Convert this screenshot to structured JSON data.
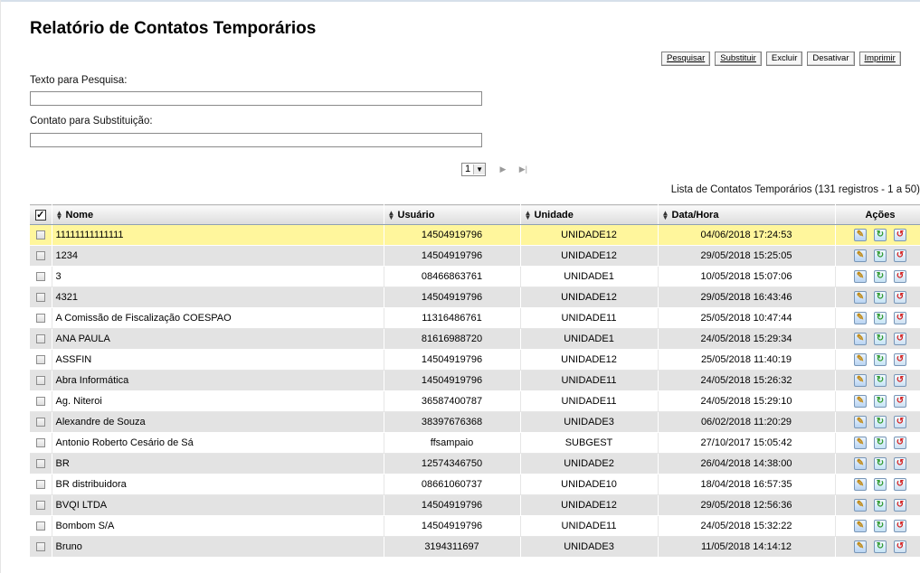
{
  "page": {
    "title": "Relatório de Contatos Temporários"
  },
  "toolbar": {
    "search_label": "Pesquisar",
    "replace_label": "Substituir",
    "delete_label": "Excluir",
    "deactivate_label": "Desativar",
    "print_label": "Imprimir"
  },
  "form": {
    "search_text_label": "Texto para Pesquisa:",
    "search_text_value": "",
    "replace_contact_label": "Contato para Substituição:",
    "replace_contact_value": ""
  },
  "pagination": {
    "current_page": "1"
  },
  "list": {
    "caption": "Lista de Contatos Temporários (131 registros - 1 a 50)",
    "columns": {
      "name": "Nome",
      "user": "Usuário",
      "unit": "Unidade",
      "datetime": "Data/Hora",
      "actions": "Ações"
    },
    "rows": [
      {
        "name": "11111111111111",
        "user": "14504919796",
        "unit": "UNIDADE12",
        "datetime": "04/06/2018 17:24:53"
      },
      {
        "name": "1234",
        "user": "14504919796",
        "unit": "UNIDADE12",
        "datetime": "29/05/2018 15:25:05"
      },
      {
        "name": "3",
        "user": "08466863761",
        "unit": "UNIDADE1",
        "datetime": "10/05/2018 15:07:06"
      },
      {
        "name": "4321",
        "user": "14504919796",
        "unit": "UNIDADE12",
        "datetime": "29/05/2018 16:43:46"
      },
      {
        "name": "A Comissão de Fiscalização COESPAO",
        "user": "11316486761",
        "unit": "UNIDADE11",
        "datetime": "25/05/2018 10:47:44"
      },
      {
        "name": "ANA PAULA",
        "user": "81616988720",
        "unit": "UNIDADE1",
        "datetime": "24/05/2018 15:29:34"
      },
      {
        "name": "ASSFIN",
        "user": "14504919796",
        "unit": "UNIDADE12",
        "datetime": "25/05/2018 11:40:19"
      },
      {
        "name": "Abra Informática",
        "user": "14504919796",
        "unit": "UNIDADE11",
        "datetime": "24/05/2018 15:26:32"
      },
      {
        "name": "Ag. Niteroi",
        "user": "36587400787",
        "unit": "UNIDADE11",
        "datetime": "24/05/2018 15:29:10"
      },
      {
        "name": "Alexandre de Souza",
        "user": "38397676368",
        "unit": "UNIDADE3",
        "datetime": "06/02/2018 11:20:29"
      },
      {
        "name": "Antonio Roberto Cesário de Sá",
        "user": "ffsampaio",
        "unit": "SUBGEST",
        "datetime": "27/10/2017 15:05:42"
      },
      {
        "name": "BR",
        "user": "12574346750",
        "unit": "UNIDADE2",
        "datetime": "26/04/2018 14:38:00"
      },
      {
        "name": "BR distribuidora",
        "user": "08661060737",
        "unit": "UNIDADE10",
        "datetime": "18/04/2018 16:57:35"
      },
      {
        "name": "BVQI LTDA",
        "user": "14504919796",
        "unit": "UNIDADE12",
        "datetime": "29/05/2018 12:56:36"
      },
      {
        "name": "Bombom S/A",
        "user": "14504919796",
        "unit": "UNIDADE11",
        "datetime": "24/05/2018 15:32:22"
      },
      {
        "name": "Bruno",
        "user": "3194311697",
        "unit": "UNIDADE3",
        "datetime": "11/05/2018 14:14:12"
      }
    ]
  },
  "icons": {
    "edit": "edit-icon",
    "activate": "activate-icon",
    "delete": "delete-icon"
  }
}
